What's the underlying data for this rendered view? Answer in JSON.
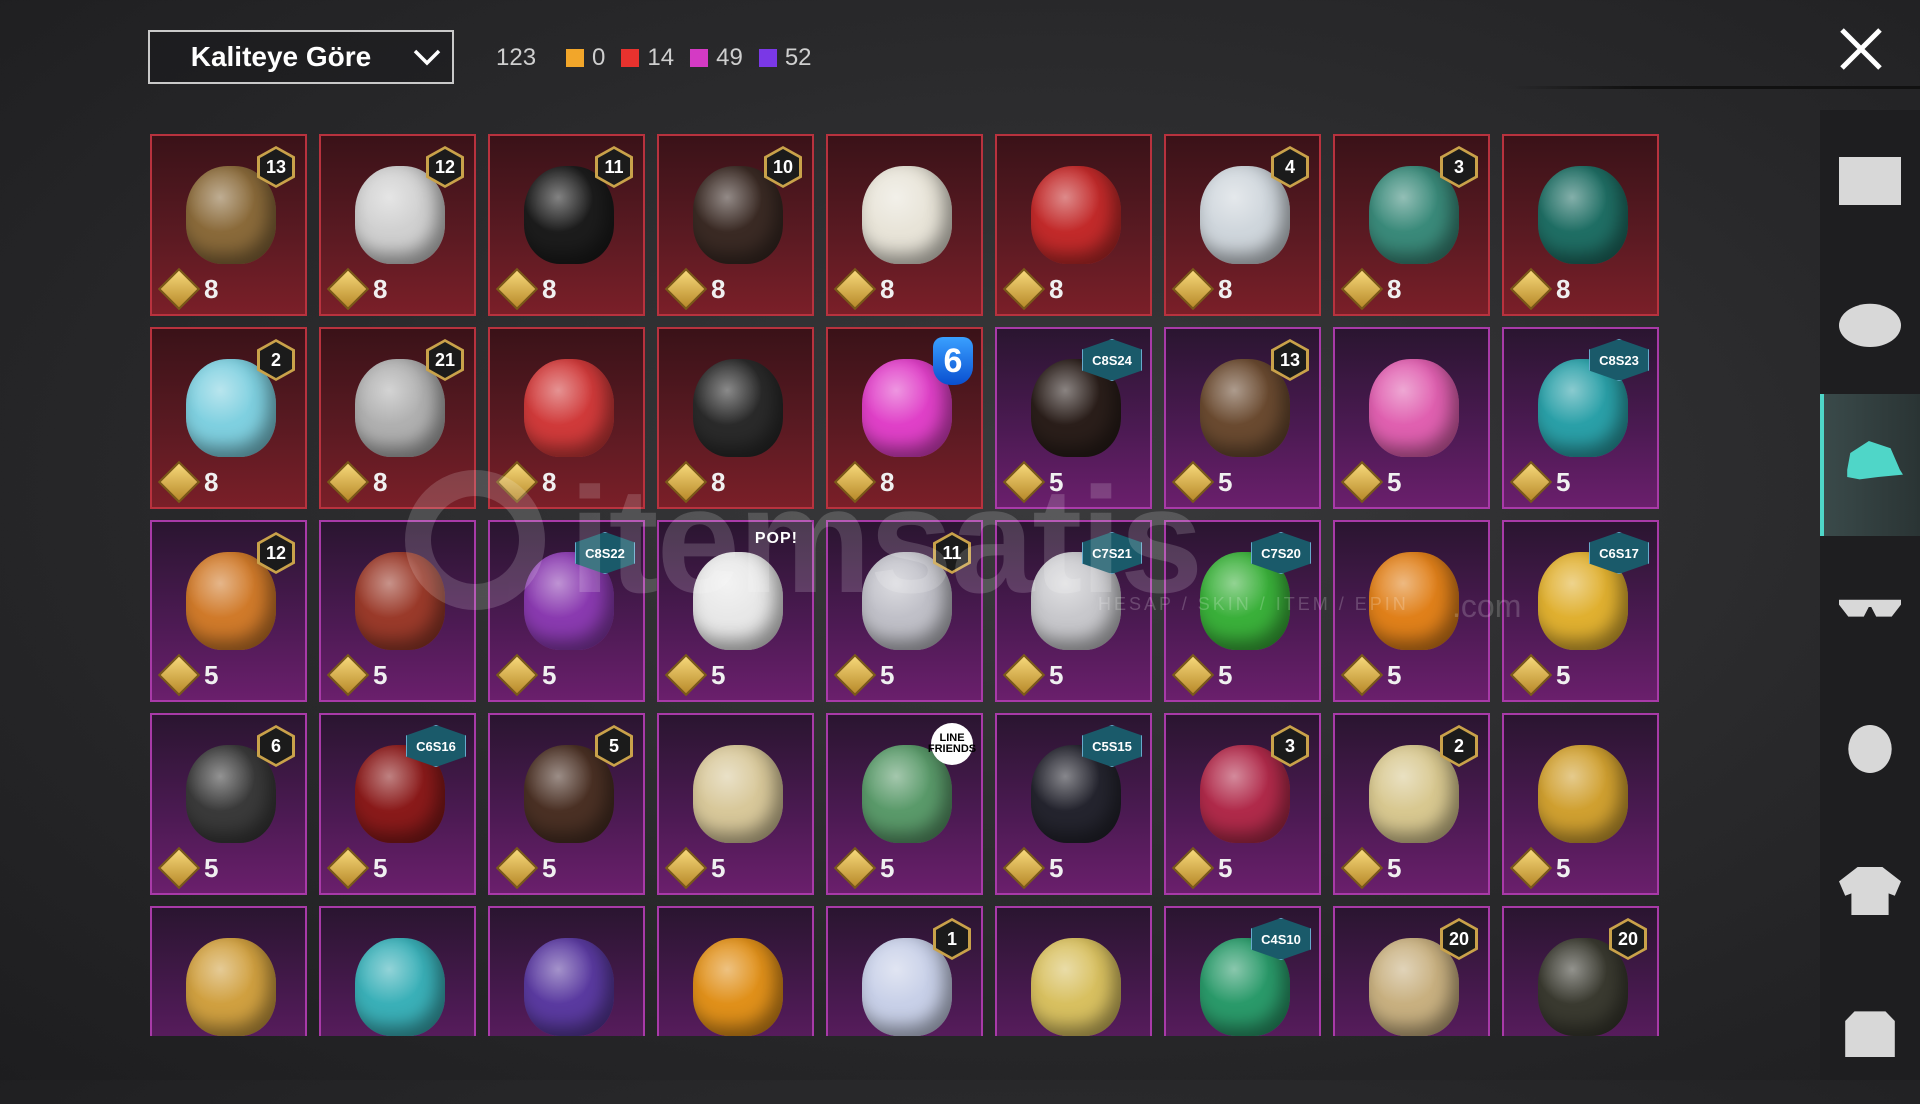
{
  "sort": {
    "label": "Kaliteye Göre"
  },
  "counts": {
    "total": "123",
    "stats": [
      {
        "color": "#f2a62a",
        "value": "0"
      },
      {
        "color": "#e8322e",
        "value": "14"
      },
      {
        "color": "#d43ac4",
        "value": "49"
      },
      {
        "color": "#7a38e6",
        "value": "52"
      }
    ]
  },
  "watermark": {
    "brand": "itemsatis",
    "tagline": "HESAP / SKIN / ITEM / EPIN",
    "suffix": ".com"
  },
  "items": [
    {
      "rarity": "red",
      "icon": "feathered-hat-icon",
      "color": "#8a6a3a",
      "tag": {
        "type": "level",
        "text": "13"
      },
      "points": "8"
    },
    {
      "rarity": "red",
      "icon": "white-hair-bow-icon",
      "color": "#d0d0d0",
      "tag": {
        "type": "level",
        "text": "12"
      },
      "points": "8"
    },
    {
      "rarity": "red",
      "icon": "black-hair-icon",
      "color": "#1c1c1c",
      "tag": {
        "type": "level",
        "text": "11"
      },
      "points": "8"
    },
    {
      "rarity": "red",
      "icon": "long-dark-hair-icon",
      "color": "#3a2a24",
      "tag": {
        "type": "level",
        "text": "10"
      },
      "points": "8"
    },
    {
      "rarity": "red",
      "icon": "white-cowboy-hat-icon",
      "color": "#e8e4d8",
      "tag": null,
      "points": "8"
    },
    {
      "rarity": "red",
      "icon": "red-helmet-icon",
      "color": "#c22a2a",
      "tag": null,
      "points": "8"
    },
    {
      "rarity": "red",
      "icon": "snowman-top-hat-icon",
      "color": "#cfd6dc",
      "tag": {
        "type": "level",
        "text": "4"
      },
      "points": "8"
    },
    {
      "rarity": "red",
      "icon": "joker-mask-icon",
      "color": "#3a8a7a",
      "tag": {
        "type": "level",
        "text": "3"
      },
      "points": "8"
    },
    {
      "rarity": "red",
      "icon": "teal-warrior-helmet-icon",
      "color": "#1f6e64",
      "tag": null,
      "points": "8"
    },
    {
      "rarity": "red",
      "icon": "cyan-bucket-hat-icon",
      "color": "#7fd0e0",
      "tag": {
        "type": "level",
        "text": "2"
      },
      "points": "8"
    },
    {
      "rarity": "red",
      "icon": "oni-mask-icon",
      "color": "#b0b0b0",
      "tag": {
        "type": "level",
        "text": "21"
      },
      "points": "8"
    },
    {
      "rarity": "red",
      "icon": "red-horned-mask-icon",
      "color": "#d03a3a",
      "tag": null,
      "points": "8"
    },
    {
      "rarity": "red",
      "icon": "black-ninja-helmet-icon",
      "color": "#2a2a2a",
      "tag": null,
      "points": "8"
    },
    {
      "rarity": "red",
      "icon": "pink-tv-head-icon",
      "color": "#e040c8",
      "tag": {
        "type": "six",
        "text": "6"
      },
      "points": "8"
    },
    {
      "rarity": "purple",
      "icon": "dark-bob-hair-icon",
      "color": "#2a1e1a",
      "tag": {
        "type": "season",
        "text": "C8S24"
      },
      "points": "5"
    },
    {
      "rarity": "purple",
      "icon": "aviator-goggles-icon",
      "color": "#6a4a30",
      "tag": {
        "type": "level",
        "text": "13"
      },
      "points": "5"
    },
    {
      "rarity": "purple",
      "icon": "pink-long-hair-icon",
      "color": "#e060b0",
      "tag": null,
      "points": "5"
    },
    {
      "rarity": "purple",
      "icon": "cat-ear-headphones-icon",
      "color": "#2aa0a8",
      "tag": {
        "type": "season",
        "text": "C8S23"
      },
      "points": "5"
    },
    {
      "rarity": "purple",
      "icon": "orange-ponytail-icon",
      "color": "#d07a2a",
      "tag": {
        "type": "level",
        "text": "12"
      },
      "points": "5"
    },
    {
      "rarity": "purple",
      "icon": "red-pigtails-icon",
      "color": "#9a3a2a",
      "tag": null,
      "points": "5"
    },
    {
      "rarity": "purple",
      "icon": "purple-teal-hair-icon",
      "color": "#8a3ab0",
      "tag": {
        "type": "season",
        "text": "C8S22"
      },
      "points": "5"
    },
    {
      "rarity": "purple",
      "icon": "panda-head-icon",
      "color": "#e8e8e8",
      "tag": {
        "type": "pop",
        "text": "POP!"
      },
      "points": "5"
    },
    {
      "rarity": "purple",
      "icon": "flower-crown-hair-icon",
      "color": "#c0c0c8",
      "tag": {
        "type": "level",
        "text": "11"
      },
      "points": "5"
    },
    {
      "rarity": "purple",
      "icon": "silver-spiky-hair-icon",
      "color": "#c8c8cc",
      "tag": {
        "type": "season",
        "text": "C7S21"
      },
      "points": "5"
    },
    {
      "rarity": "purple",
      "icon": "green-pigtails-icon",
      "color": "#3ab03a",
      "tag": {
        "type": "season",
        "text": "C7S20"
      },
      "points": "5"
    },
    {
      "rarity": "purple",
      "icon": "pumpkin-head-icon",
      "color": "#e0801a",
      "tag": null,
      "points": "5"
    },
    {
      "rarity": "purple",
      "icon": "yellow-visor-icon",
      "color": "#e0b030",
      "tag": {
        "type": "season",
        "text": "C6S17"
      },
      "points": "5"
    },
    {
      "rarity": "purple",
      "icon": "silver-knight-helmet-icon",
      "color": "#3a3a3a",
      "tag": {
        "type": "level",
        "text": "6"
      },
      "points": "5"
    },
    {
      "rarity": "purple",
      "icon": "red-bob-hair-icon",
      "color": "#8a1a1a",
      "tag": {
        "type": "season",
        "text": "C6S16"
      },
      "points": "5"
    },
    {
      "rarity": "purple",
      "icon": "bow-pigtails-icon",
      "color": "#4a3024",
      "tag": {
        "type": "level",
        "text": "5"
      },
      "points": "5"
    },
    {
      "rarity": "purple",
      "icon": "blonde-goggle-hair-icon",
      "color": "#d8c89a",
      "tag": null,
      "points": "5"
    },
    {
      "rarity": "purple",
      "icon": "brown-bear-dragon-hat-icon",
      "color": "#5a9a6a",
      "tag": {
        "type": "line",
        "text": "LINE FRIENDS"
      },
      "points": "5"
    },
    {
      "rarity": "purple",
      "icon": "black-cap-icon",
      "color": "#24242e",
      "tag": {
        "type": "season",
        "text": "C5S15"
      },
      "points": "5"
    },
    {
      "rarity": "purple",
      "icon": "jester-hat-icon",
      "color": "#b02a4a",
      "tag": {
        "type": "level",
        "text": "3"
      },
      "points": "5"
    },
    {
      "rarity": "purple",
      "icon": "bandana-blonde-hair-icon",
      "color": "#d8c890",
      "tag": {
        "type": "level",
        "text": "2"
      },
      "points": "5"
    },
    {
      "rarity": "purple",
      "icon": "yellow-cap-icon",
      "color": "#d0a030",
      "tag": null,
      "points": "5"
    },
    {
      "rarity": "purple",
      "icon": "feather-headdress-icon",
      "color": "#d0a040",
      "tag": null,
      "points": ""
    },
    {
      "rarity": "purple",
      "icon": "teal-creature-hat-icon",
      "color": "#3ab0b8",
      "tag": null,
      "points": ""
    },
    {
      "rarity": "purple",
      "icon": "headphone-pigtails-icon",
      "color": "#5a3aa0",
      "tag": null,
      "points": ""
    },
    {
      "rarity": "purple",
      "icon": "orange-bird-head-icon",
      "color": "#e0901a",
      "tag": null,
      "points": ""
    },
    {
      "rarity": "purple",
      "icon": "pastel-pigtails-icon",
      "color": "#c8d0e8",
      "tag": {
        "type": "level",
        "text": "1"
      },
      "points": ""
    },
    {
      "rarity": "purple",
      "icon": "yellow-beanie-icon",
      "color": "#d8c060",
      "tag": null,
      "points": ""
    },
    {
      "rarity": "purple",
      "icon": "green-monster-helmet-icon",
      "color": "#2a9a6a",
      "tag": {
        "type": "season",
        "text": "C4S10"
      },
      "points": ""
    },
    {
      "rarity": "purple",
      "icon": "bunny-ear-hat-icon",
      "color": "#c8b080",
      "tag": {
        "type": "level",
        "text": "20"
      },
      "points": ""
    },
    {
      "rarity": "purple",
      "icon": "gold-skull-helmet-icon",
      "color": "#3a3a30",
      "tag": {
        "type": "level",
        "text": "20"
      },
      "points": ""
    }
  ],
  "sidebar": [
    {
      "name": "outfit-category",
      "icon": "outfit-icon",
      "active": false
    },
    {
      "name": "helmet-category",
      "icon": "helmet-icon",
      "active": false
    },
    {
      "name": "hat-category",
      "icon": "cap-icon",
      "active": true
    },
    {
      "name": "glasses-category",
      "icon": "glasses-icon",
      "active": false
    },
    {
      "name": "mask-category",
      "icon": "mask-icon",
      "active": false
    },
    {
      "name": "jacket-category",
      "icon": "jacket-icon",
      "active": false
    },
    {
      "name": "backpack-category",
      "icon": "backpack-icon",
      "active": false
    }
  ]
}
